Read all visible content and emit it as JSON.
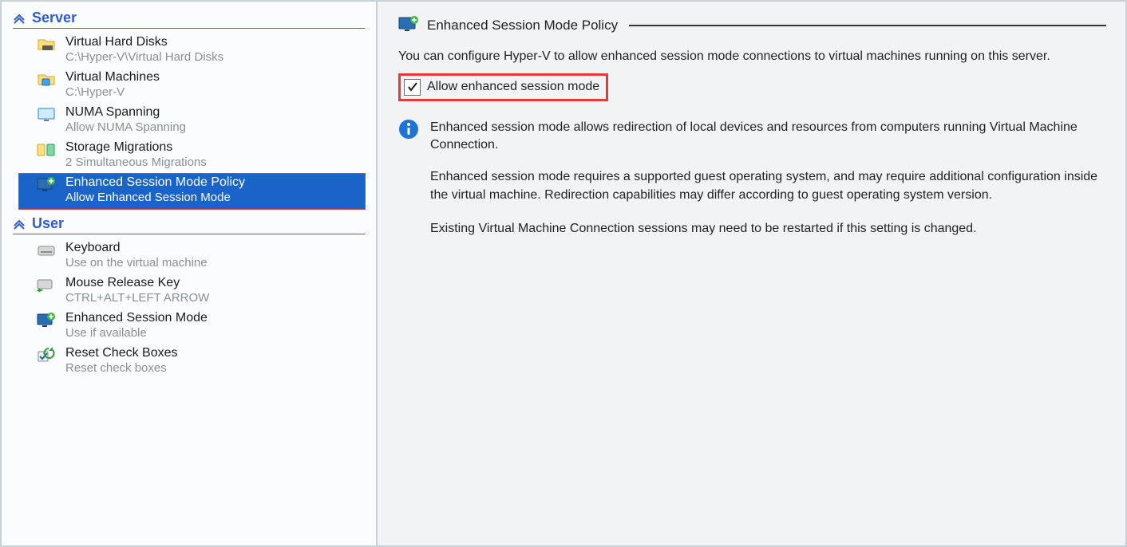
{
  "categories": {
    "server": {
      "title": "Server",
      "items": [
        {
          "title": "Virtual Hard Disks",
          "sub": "C:\\Hyper-V\\Virtual Hard Disks"
        },
        {
          "title": "Virtual Machines",
          "sub": "C:\\Hyper-V"
        },
        {
          "title": "NUMA Spanning",
          "sub": "Allow NUMA Spanning"
        },
        {
          "title": "Storage Migrations",
          "sub": "2 Simultaneous Migrations"
        },
        {
          "title": "Enhanced Session Mode Policy",
          "sub": "Allow Enhanced Session Mode"
        }
      ]
    },
    "user": {
      "title": "User",
      "items": [
        {
          "title": "Keyboard",
          "sub": "Use on the virtual machine"
        },
        {
          "title": "Mouse Release Key",
          "sub": "CTRL+ALT+LEFT ARROW"
        },
        {
          "title": "Enhanced Session Mode",
          "sub": "Use if available"
        },
        {
          "title": "Reset Check Boxes",
          "sub": "Reset check boxes"
        }
      ]
    }
  },
  "detail": {
    "heading": "Enhanced Session Mode Policy",
    "intro": "You can configure Hyper-V to allow enhanced session mode connections to virtual machines running on this server.",
    "checkbox_label": "Allow enhanced session mode",
    "info1": "Enhanced session mode allows redirection of local devices and resources from computers running Virtual Machine Connection.",
    "info2": "Enhanced session mode requires a supported guest operating system, and may require additional configuration inside the virtual machine. Redirection capabilities may differ according to guest operating system version.",
    "info3": "Existing Virtual Machine Connection sessions may need to be restarted if this setting is changed."
  },
  "colors": {
    "accent_blue": "#2f5cd3",
    "selection_blue": "#1a63c9",
    "highlight_red": "#e23b3b"
  }
}
